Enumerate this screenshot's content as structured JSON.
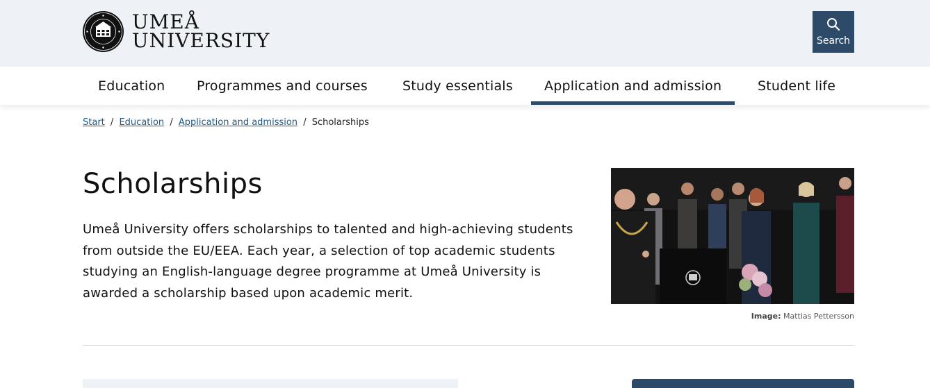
{
  "header": {
    "logo_line1": "UMEÅ",
    "logo_line2": "UNIVERSITY",
    "search_label": "Search"
  },
  "nav": {
    "items": [
      {
        "label": "Education"
      },
      {
        "label": "Programmes and courses"
      },
      {
        "label": "Study essentials"
      },
      {
        "label": "Application and admission",
        "active": true
      },
      {
        "label": "Student life"
      }
    ]
  },
  "breadcrumb": {
    "start": "Start",
    "education": "Education",
    "application": "Application and admission",
    "current": "Scholarships",
    "separator": "/"
  },
  "main": {
    "title": "Scholarships",
    "lead": "Umeå University offers scholarships to talented and high-achieving students from outside the EU/EEA. Each year, a selection of top academic students studying an English-language degree programme at Umeå University is awarded a scholarship based upon academic merit.",
    "image_caption_label": "Image:",
    "image_caption_credit": "Mattias Pettersson"
  },
  "colors": {
    "header_bg": "#eef2f7",
    "accent": "#2e4a69",
    "link": "#1d5a8a"
  }
}
